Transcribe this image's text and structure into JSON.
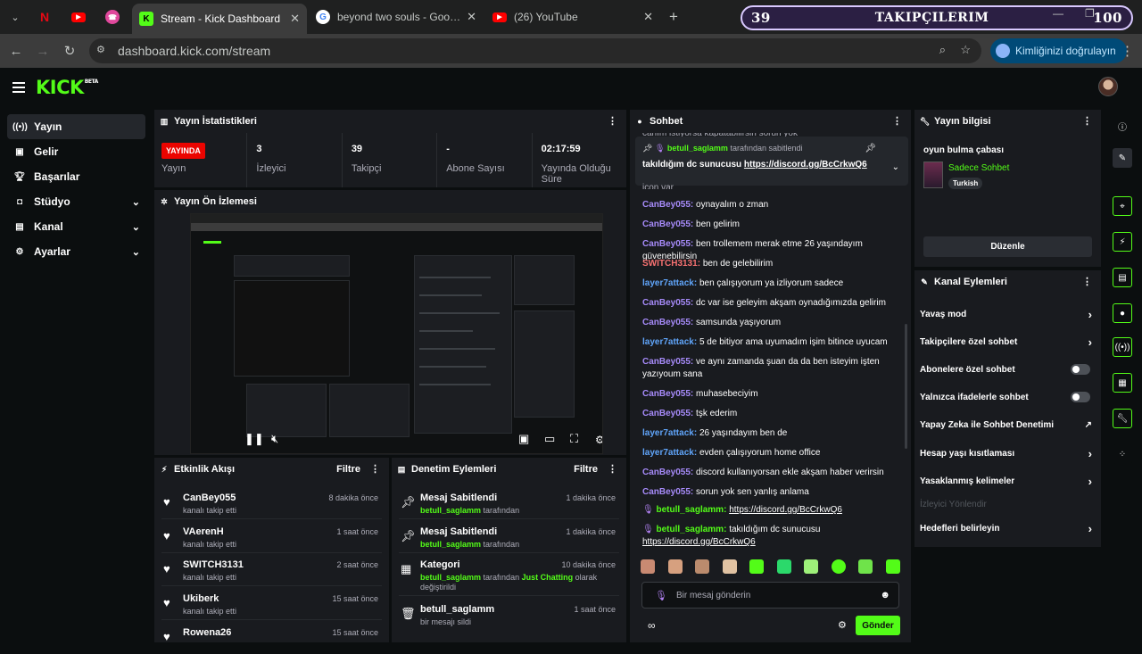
{
  "browser": {
    "tabs": [
      {
        "title": "Stream - Kick Dashboard"
      },
      {
        "title": "beyond two souls - Google'da A"
      },
      {
        "title": "(26) YouTube"
      }
    ],
    "url": "dashboard.kick.com/stream",
    "verify_label": "Kimliğinizi doğrulayın"
  },
  "banner": {
    "left": "39",
    "mid": "TAKIPÇILERIM",
    "right": "100"
  },
  "sidebar": {
    "items": [
      {
        "label": "Yayın"
      },
      {
        "label": "Gelir"
      },
      {
        "label": "Başarılar"
      },
      {
        "label": "Stüdyo"
      },
      {
        "label": "Kanal"
      },
      {
        "label": "Ayarlar"
      }
    ]
  },
  "stats": {
    "title": "Yayın İstatistikleri",
    "live_badge": "YAYINDA",
    "items": [
      {
        "value": "",
        "label": "Yayın"
      },
      {
        "value": "3",
        "label": "İzleyici"
      },
      {
        "value": "39",
        "label": "Takipçi"
      },
      {
        "value": "-",
        "label": "Abone Sayısı"
      },
      {
        "value": "02:17:59",
        "label": "Yayında Olduğu Süre"
      }
    ]
  },
  "preview": {
    "title": "Yayın Ön İzlemesi"
  },
  "activity": {
    "title": "Etkinlik Akışı",
    "filter": "Filtre",
    "items": [
      {
        "name": "CanBey055",
        "sub": "kanalı takip etti",
        "time": "8 dakika önce"
      },
      {
        "name": "VAerenH",
        "sub": "kanalı takip etti",
        "time": "1 saat önce"
      },
      {
        "name": "SWITCH3131",
        "sub": "kanalı takip etti",
        "time": "2 saat önce"
      },
      {
        "name": "Ukiberk",
        "sub": "kanalı takip etti",
        "time": "15 saat önce"
      },
      {
        "name": "Rowena26",
        "sub": "",
        "time": "15 saat önce"
      }
    ]
  },
  "moderation": {
    "title": "Denetim Eylemleri",
    "filter": "Filtre",
    "items": [
      {
        "name": "Mesaj Sabitlendi",
        "user": "betull_saglamm",
        "sub": "tarafından",
        "extra": "",
        "tail": "",
        "time": "1 dakika önce"
      },
      {
        "name": "Mesaj Sabitlendi",
        "user": "betull_saglamm",
        "sub": "tarafından",
        "extra": "",
        "tail": "",
        "time": "1 dakika önce"
      },
      {
        "name": "Kategori",
        "user": "betull_saglamm",
        "sub": "tarafından",
        "extra": "Just Chatting",
        "tail": "olarak değiştirildi",
        "time": "10 dakika önce"
      },
      {
        "name": "betull_saglamm",
        "user": "",
        "sub": "bir mesajı sildi",
        "extra": "",
        "tail": "",
        "time": "1 saat önce"
      }
    ]
  },
  "chat": {
    "title": "Sohbet",
    "top_cut": "canım istiyorsa kapatabilirsin sorun yok",
    "pinned": {
      "user": "betull_saglamm",
      "by": "tarafından sabitlendi",
      "text": "takıldığım dc sunucusu",
      "link": "https://discord.gg/BcCrkwQ6"
    },
    "cut_msg": "içon var",
    "messages": [
      {
        "user": "CanBey055",
        "color": "#a78bfa",
        "text": "oynayalım o zman"
      },
      {
        "user": "CanBey055",
        "color": "#a78bfa",
        "text": "ben gelirim"
      },
      {
        "user": "CanBey055",
        "color": "#a78bfa",
        "text": "ben trollemem merak etme 26 yaşındayım güvenebilirsin"
      },
      {
        "user": "SWITCH3131",
        "color": "#f87171",
        "text": "ben de gelebilirim"
      },
      {
        "user": "layer7attack",
        "color": "#60a5fa",
        "text": "ben çalışıyorum ya izliyorum sadece"
      },
      {
        "user": "CanBey055",
        "color": "#a78bfa",
        "text": "dc var ise geleyim akşam oynadığımızda gelirim"
      },
      {
        "user": "CanBey055",
        "color": "#a78bfa",
        "text": "samsunda yaşıyorum"
      },
      {
        "user": "layer7attack",
        "color": "#60a5fa",
        "text": "5 de bitiyor ama uyumadım işim bitince uyucam"
      },
      {
        "user": "CanBey055",
        "color": "#a78bfa",
        "text": "ve aynı zamanda şuan da da ben isteyim işten yazıyoum sana"
      },
      {
        "user": "CanBey055",
        "color": "#a78bfa",
        "text": "muhasebeciyim"
      },
      {
        "user": "CanBey055",
        "color": "#a78bfa",
        "text": "tşk ederim"
      },
      {
        "user": "layer7attack",
        "color": "#60a5fa",
        "text": "26 yaşındayım ben de"
      },
      {
        "user": "layer7attack",
        "color": "#60a5fa",
        "text": "evden çalışıyorum home office"
      },
      {
        "user": "CanBey055",
        "color": "#a78bfa",
        "text": "discord kullanıyorsan ekle akşam haber verirsin"
      },
      {
        "user": "CanBey055",
        "color": "#a78bfa",
        "text": "sorun yok sen yanlış anlama"
      }
    ],
    "link_msg": {
      "user": "betull_saglamm",
      "link": "https://discord.gg/BcCrkwQ6"
    },
    "last_msg": {
      "user": "betull_saglamm",
      "text": "takıldığım dc sunucusu",
      "link": "https://discord.gg/BcCrkwQ6"
    },
    "input_placeholder": "Bir mesaj gönderin",
    "send": "Gönder"
  },
  "info": {
    "title": "Yayın bilgisi",
    "stream_title": "oyun bulma çabası",
    "category": "Sadece Sohbet",
    "tag": "Turkish",
    "edit": "Düzenle"
  },
  "actions": {
    "title": "Kanal Eylemleri",
    "items": [
      {
        "label": "Yavaş mod",
        "kind": "arrow"
      },
      {
        "label": "Takipçilere özel sohbet",
        "kind": "arrow"
      },
      {
        "label": "Abonelere özel sohbet",
        "kind": "toggle"
      },
      {
        "label": "Yalnızca ifadelerle sohbet",
        "kind": "toggle"
      },
      {
        "label": "Yapay Zeka ile Sohbet Denetimi",
        "kind": "ext"
      },
      {
        "label": "Hesap yaşı kısıtlaması",
        "kind": "arrow"
      },
      {
        "label": "Yasaklanmış kelimeler",
        "kind": "arrow"
      },
      {
        "label": "İzleyici Yönlendir",
        "kind": "dim"
      },
      {
        "label": "Hedefleri belirleyin",
        "kind": "arrow"
      }
    ]
  },
  "colors": {
    "brand": "#53fc18",
    "live": "#eb0400"
  }
}
